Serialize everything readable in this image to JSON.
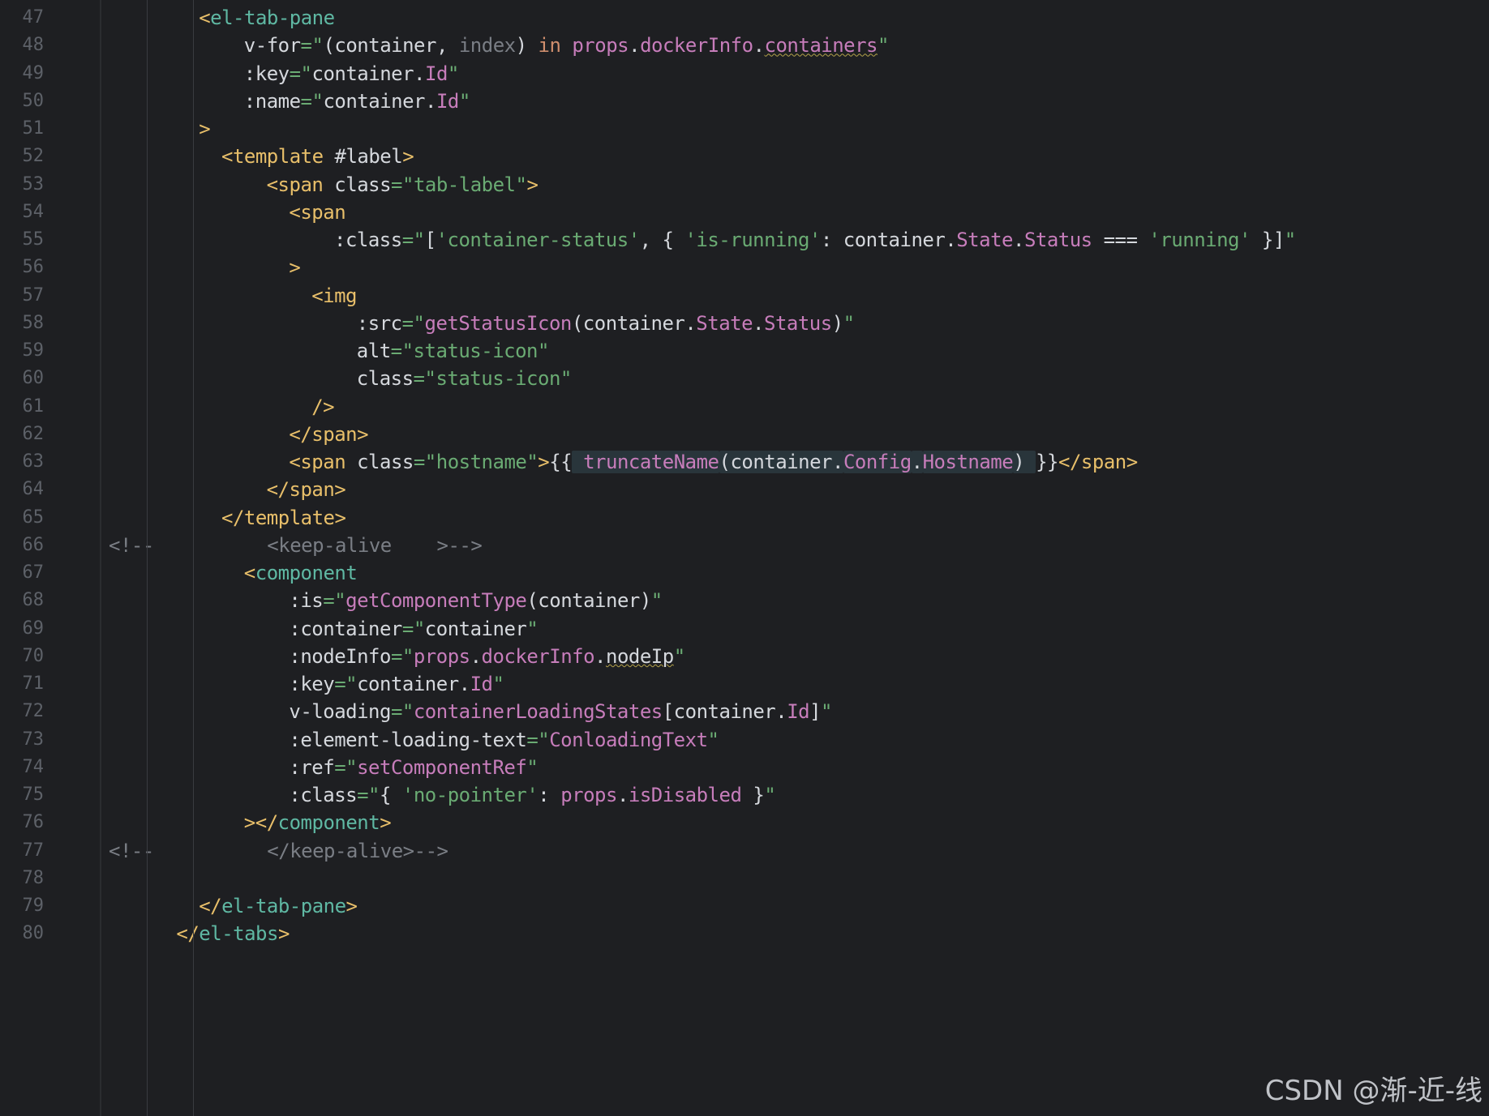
{
  "editor": {
    "colors": {
      "background": "#1e1f22",
      "line_number": "#5d6168",
      "tag": "#e8bf6a",
      "tag_name_green": "#5fb8a3",
      "attr": "#d5d8dd",
      "string": "#6aab73",
      "member": "#c77dbb",
      "comment": "#7a7e85",
      "keyword": "#cf8e6d",
      "function": "#c77dbb"
    },
    "lines": [
      {
        "n": "47",
        "indent": 8,
        "tokens": [
          {
            "t": "<",
            "c": "tag"
          },
          {
            "t": "el-tab-pane",
            "c": "tag_name_green"
          }
        ]
      },
      {
        "n": "48",
        "indent": 12,
        "tokens": [
          {
            "t": "v-for",
            "c": "attr"
          },
          {
            "t": "=\"",
            "c": "string"
          },
          {
            "t": "(container, ",
            "c": "attr"
          },
          {
            "t": "index",
            "c": "comment"
          },
          {
            "t": ") ",
            "c": "attr"
          },
          {
            "t": "in ",
            "c": "keyword"
          },
          {
            "t": "props",
            "c": "member"
          },
          {
            "t": ".",
            "c": "attr"
          },
          {
            "t": "dockerInfo",
            "c": "member"
          },
          {
            "t": ".",
            "c": "attr"
          },
          {
            "t": "containers",
            "c": "member",
            "sq": true
          },
          {
            "t": "\"",
            "c": "string"
          }
        ]
      },
      {
        "n": "49",
        "indent": 12,
        "tokens": [
          {
            "t": ":key",
            "c": "attr"
          },
          {
            "t": "=\"",
            "c": "string"
          },
          {
            "t": "container.",
            "c": "attr"
          },
          {
            "t": "Id",
            "c": "member"
          },
          {
            "t": "\"",
            "c": "string"
          }
        ]
      },
      {
        "n": "50",
        "indent": 12,
        "tokens": [
          {
            "t": ":name",
            "c": "attr"
          },
          {
            "t": "=\"",
            "c": "string"
          },
          {
            "t": "container.",
            "c": "attr"
          },
          {
            "t": "Id",
            "c": "member"
          },
          {
            "t": "\"",
            "c": "string"
          }
        ]
      },
      {
        "n": "51",
        "indent": 8,
        "tokens": [
          {
            "t": ">",
            "c": "tag"
          }
        ]
      },
      {
        "n": "52",
        "indent": 10,
        "tokens": [
          {
            "t": "<template ",
            "c": "tag"
          },
          {
            "t": "#label",
            "c": "attr"
          },
          {
            "t": ">",
            "c": "tag"
          }
        ]
      },
      {
        "n": "53",
        "indent": 14,
        "tokens": [
          {
            "t": "<span ",
            "c": "tag"
          },
          {
            "t": "class",
            "c": "attr"
          },
          {
            "t": "=\"tab-label\"",
            "c": "string"
          },
          {
            "t": ">",
            "c": "tag"
          }
        ]
      },
      {
        "n": "54",
        "indent": 16,
        "tokens": [
          {
            "t": "<span",
            "c": "tag"
          }
        ]
      },
      {
        "n": "55",
        "indent": 20,
        "tokens": [
          {
            "t": ":class",
            "c": "attr"
          },
          {
            "t": "=\"",
            "c": "string"
          },
          {
            "t": "[",
            "c": "attr"
          },
          {
            "t": "'container-status'",
            "c": "string"
          },
          {
            "t": ", { ",
            "c": "attr"
          },
          {
            "t": "'is-running'",
            "c": "string"
          },
          {
            "t": ": container.",
            "c": "attr"
          },
          {
            "t": "State",
            "c": "member"
          },
          {
            "t": ".",
            "c": "attr"
          },
          {
            "t": "Status",
            "c": "member"
          },
          {
            "t": " === ",
            "c": "attr"
          },
          {
            "t": "'running'",
            "c": "string"
          },
          {
            "t": " }]",
            "c": "attr"
          },
          {
            "t": "\"",
            "c": "string"
          }
        ]
      },
      {
        "n": "56",
        "indent": 16,
        "tokens": [
          {
            "t": ">",
            "c": "tag"
          }
        ]
      },
      {
        "n": "57",
        "indent": 18,
        "tokens": [
          {
            "t": "<img",
            "c": "tag"
          }
        ]
      },
      {
        "n": "58",
        "indent": 22,
        "tokens": [
          {
            "t": ":src",
            "c": "attr"
          },
          {
            "t": "=\"",
            "c": "string"
          },
          {
            "t": "getStatusIcon",
            "c": "function"
          },
          {
            "t": "(container.",
            "c": "attr"
          },
          {
            "t": "State",
            "c": "member"
          },
          {
            "t": ".",
            "c": "attr"
          },
          {
            "t": "Status",
            "c": "member"
          },
          {
            "t": ")",
            "c": "attr"
          },
          {
            "t": "\"",
            "c": "string"
          }
        ]
      },
      {
        "n": "59",
        "indent": 22,
        "tokens": [
          {
            "t": "alt",
            "c": "attr"
          },
          {
            "t": "=\"status-icon\"",
            "c": "string"
          }
        ]
      },
      {
        "n": "60",
        "indent": 22,
        "tokens": [
          {
            "t": "class",
            "c": "attr"
          },
          {
            "t": "=\"status-icon\"",
            "c": "string"
          }
        ]
      },
      {
        "n": "61",
        "indent": 18,
        "tokens": [
          {
            "t": "/>",
            "c": "tag"
          }
        ]
      },
      {
        "n": "62",
        "indent": 16,
        "tokens": [
          {
            "t": "</span>",
            "c": "tag"
          }
        ]
      },
      {
        "n": "63",
        "indent": 16,
        "tokens": [
          {
            "t": "<span ",
            "c": "tag"
          },
          {
            "t": "class",
            "c": "attr"
          },
          {
            "t": "=\"hostname\"",
            "c": "string"
          },
          {
            "t": ">",
            "c": "tag"
          },
          {
            "t": "{{",
            "c": "attr"
          },
          {
            "t": " truncateName",
            "c": "function",
            "hl": true
          },
          {
            "t": "(container.",
            "c": "attr",
            "hl": true
          },
          {
            "t": "Config",
            "c": "member",
            "hl": true
          },
          {
            "t": ".",
            "c": "attr",
            "hl": true
          },
          {
            "t": "Hostname",
            "c": "member",
            "hl": true
          },
          {
            "t": ") ",
            "c": "attr",
            "hl": true
          },
          {
            "t": "}}",
            "c": "attr"
          },
          {
            "t": "</span>",
            "c": "tag"
          }
        ]
      },
      {
        "n": "64",
        "indent": 14,
        "tokens": [
          {
            "t": "</span>",
            "c": "tag"
          }
        ]
      },
      {
        "n": "65",
        "indent": 10,
        "tokens": [
          {
            "t": "</template>",
            "c": "tag"
          }
        ]
      },
      {
        "n": "66",
        "indent": 0,
        "tokens": [
          {
            "t": "<!--",
            "c": "comment"
          },
          {
            "t": "          <keep-alive    >-->",
            "c": "comment"
          }
        ]
      },
      {
        "n": "67",
        "indent": 12,
        "tokens": [
          {
            "t": "<",
            "c": "tag"
          },
          {
            "t": "component",
            "c": "tag_name_green"
          }
        ]
      },
      {
        "n": "68",
        "indent": 16,
        "tokens": [
          {
            "t": ":is",
            "c": "attr"
          },
          {
            "t": "=\"",
            "c": "string"
          },
          {
            "t": "getComponentType",
            "c": "function"
          },
          {
            "t": "(container)",
            "c": "attr"
          },
          {
            "t": "\"",
            "c": "string"
          }
        ]
      },
      {
        "n": "69",
        "indent": 16,
        "tokens": [
          {
            "t": ":container",
            "c": "attr"
          },
          {
            "t": "=\"",
            "c": "string"
          },
          {
            "t": "container",
            "c": "attr"
          },
          {
            "t": "\"",
            "c": "string"
          }
        ]
      },
      {
        "n": "70",
        "indent": 16,
        "tokens": [
          {
            "t": ":nodeInfo",
            "c": "attr"
          },
          {
            "t": "=\"",
            "c": "string"
          },
          {
            "t": "props",
            "c": "member"
          },
          {
            "t": ".",
            "c": "attr"
          },
          {
            "t": "dockerInfo",
            "c": "member"
          },
          {
            "t": ".",
            "c": "attr"
          },
          {
            "t": "nodeIp",
            "c": "attr",
            "sq": true
          },
          {
            "t": "\"",
            "c": "string"
          }
        ]
      },
      {
        "n": "71",
        "indent": 16,
        "tokens": [
          {
            "t": ":key",
            "c": "attr"
          },
          {
            "t": "=\"",
            "c": "string"
          },
          {
            "t": "container.",
            "c": "attr"
          },
          {
            "t": "Id",
            "c": "member"
          },
          {
            "t": "\"",
            "c": "string"
          }
        ]
      },
      {
        "n": "72",
        "indent": 16,
        "tokens": [
          {
            "t": "v-loading",
            "c": "attr"
          },
          {
            "t": "=\"",
            "c": "string"
          },
          {
            "t": "containerLoadingStates",
            "c": "member"
          },
          {
            "t": "[container.",
            "c": "attr"
          },
          {
            "t": "Id",
            "c": "member"
          },
          {
            "t": "]",
            "c": "attr"
          },
          {
            "t": "\"",
            "c": "string"
          }
        ]
      },
      {
        "n": "73",
        "indent": 16,
        "tokens": [
          {
            "t": ":element-loading-text",
            "c": "attr"
          },
          {
            "t": "=\"",
            "c": "string"
          },
          {
            "t": "ConloadingText",
            "c": "member"
          },
          {
            "t": "\"",
            "c": "string"
          }
        ]
      },
      {
        "n": "74",
        "indent": 16,
        "tokens": [
          {
            "t": ":ref",
            "c": "attr"
          },
          {
            "t": "=\"",
            "c": "string"
          },
          {
            "t": "setComponentRef",
            "c": "member"
          },
          {
            "t": "\"",
            "c": "string"
          }
        ]
      },
      {
        "n": "75",
        "indent": 16,
        "tokens": [
          {
            "t": ":class",
            "c": "attr"
          },
          {
            "t": "=\"",
            "c": "string"
          },
          {
            "t": "{ ",
            "c": "attr"
          },
          {
            "t": "'no-pointer'",
            "c": "string"
          },
          {
            "t": ": ",
            "c": "attr"
          },
          {
            "t": "props",
            "c": "member"
          },
          {
            "t": ".",
            "c": "attr"
          },
          {
            "t": "isDisabled",
            "c": "member"
          },
          {
            "t": " }",
            "c": "attr"
          },
          {
            "t": "\"",
            "c": "string"
          }
        ]
      },
      {
        "n": "76",
        "indent": 12,
        "tokens": [
          {
            "t": "></",
            "c": "tag"
          },
          {
            "t": "component",
            "c": "tag_name_green"
          },
          {
            "t": ">",
            "c": "tag"
          }
        ]
      },
      {
        "n": "77",
        "indent": 0,
        "tokens": [
          {
            "t": "<!--",
            "c": "comment"
          },
          {
            "t": "          </keep-alive>-->",
            "c": "comment"
          }
        ]
      },
      {
        "n": "78",
        "indent": 0,
        "tokens": []
      },
      {
        "n": "79",
        "indent": 8,
        "tokens": [
          {
            "t": "</",
            "c": "tag"
          },
          {
            "t": "el-tab-pane",
            "c": "tag_name_green"
          },
          {
            "t": ">",
            "c": "tag"
          }
        ]
      },
      {
        "n": "80",
        "indent": 6,
        "tokens": [
          {
            "t": "</",
            "c": "tag"
          },
          {
            "t": "el-tabs",
            "c": "tag_name_green"
          },
          {
            "t": ">",
            "c": "tag"
          }
        ]
      }
    ]
  },
  "watermark": "CSDN @渐-近-线"
}
